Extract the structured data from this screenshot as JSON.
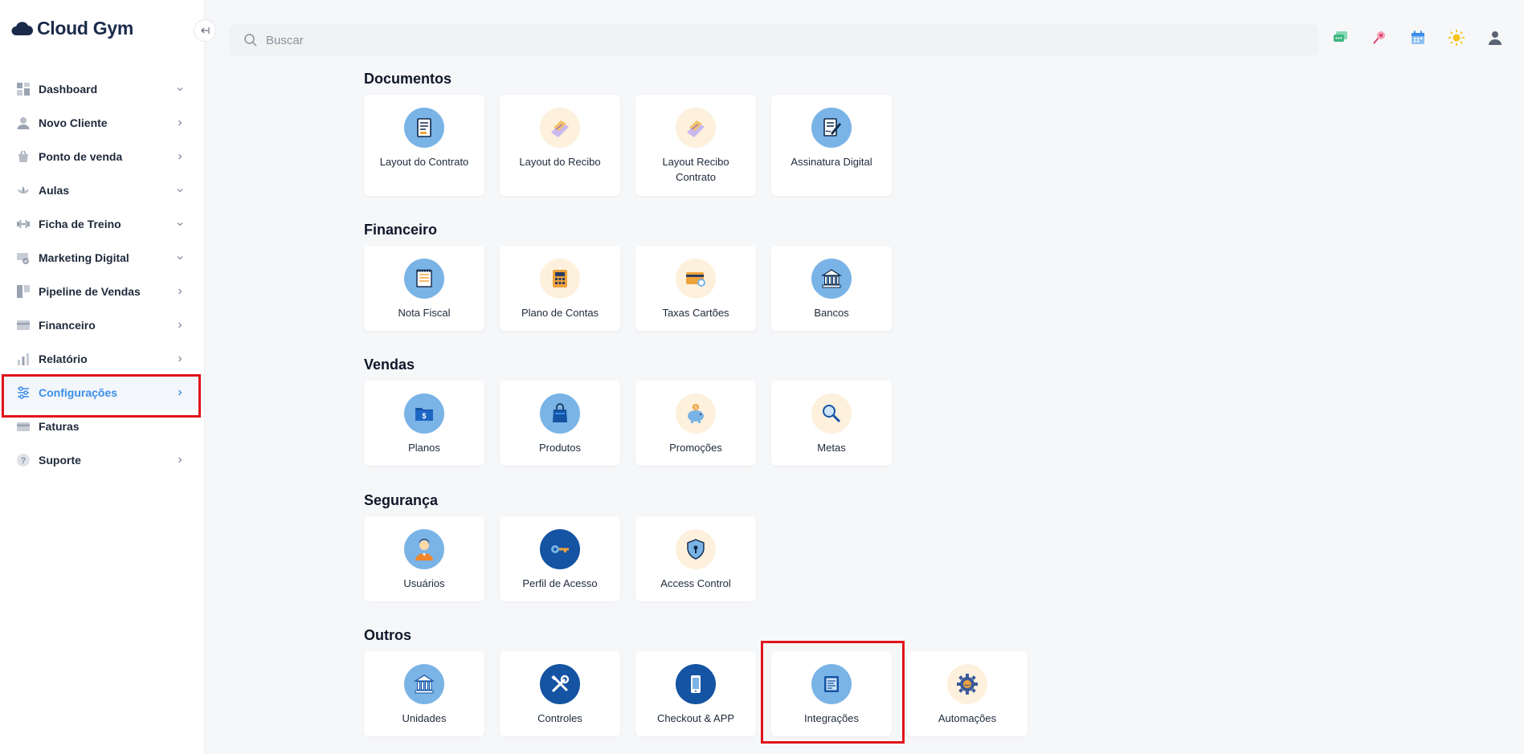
{
  "app": {
    "logo_text": "Cloud Gym"
  },
  "search": {
    "placeholder": "Buscar"
  },
  "sidebar": {
    "items": [
      {
        "label": "Dashboard",
        "icon": "dashboard-icon",
        "chevron": "down"
      },
      {
        "label": "Novo Cliente",
        "icon": "user-icon",
        "chevron": "right"
      },
      {
        "label": "Ponto de venda",
        "icon": "basket-icon",
        "chevron": "right"
      },
      {
        "label": "Aulas",
        "icon": "lotus-icon",
        "chevron": "down"
      },
      {
        "label": "Ficha de Treino",
        "icon": "dumbbell-icon",
        "chevron": "down"
      },
      {
        "label": "Marketing Digital",
        "icon": "marketing-icon",
        "chevron": "down"
      },
      {
        "label": "Pipeline de Vendas",
        "icon": "pipeline-icon",
        "chevron": "right"
      },
      {
        "label": "Financeiro",
        "icon": "finance-icon",
        "chevron": "right"
      },
      {
        "label": "Relatório",
        "icon": "bar-chart-icon",
        "chevron": "right"
      },
      {
        "label": "Configurações",
        "icon": "sliders-icon",
        "chevron": "right",
        "active": true
      },
      {
        "label": "Faturas",
        "icon": "credit-card-icon",
        "chevron": ""
      },
      {
        "label": "Suporte",
        "icon": "help-icon",
        "chevron": "right"
      }
    ]
  },
  "topbar": {
    "icons": [
      "chat-icon",
      "pin-icon",
      "calendar-icon",
      "sun-icon",
      "user-profile-icon"
    ]
  },
  "sections": [
    {
      "title": "Documentos",
      "cards": [
        {
          "label": "Layout do Contrato",
          "icon": "contract-icon",
          "style": "blue"
        },
        {
          "label": "Layout do Recibo",
          "icon": "receipt-icon",
          "style": "cream"
        },
        {
          "label": "Layout Recibo Contrato",
          "icon": "receipt-contract-icon",
          "style": "cream"
        },
        {
          "label": "Assinatura Digital",
          "icon": "signature-icon",
          "style": "blue"
        }
      ]
    },
    {
      "title": "Financeiro",
      "cards": [
        {
          "label": "Nota Fiscal",
          "icon": "invoice-icon",
          "style": "blue"
        },
        {
          "label": "Plano de Contas",
          "icon": "calculator-icon",
          "style": "cream"
        },
        {
          "label": "Taxas Cartões",
          "icon": "card-fees-icon",
          "style": "cream"
        },
        {
          "label": "Bancos",
          "icon": "bank-icon",
          "style": "blue"
        }
      ]
    },
    {
      "title": "Vendas",
      "cards": [
        {
          "label": "Planos",
          "icon": "folder-money-icon",
          "style": "blue"
        },
        {
          "label": "Produtos",
          "icon": "shopping-bag-icon",
          "style": "blue"
        },
        {
          "label": "Promoções",
          "icon": "piggy-bank-icon",
          "style": "cream"
        },
        {
          "label": "Metas",
          "icon": "magnifier-icon",
          "style": "cream"
        }
      ]
    },
    {
      "title": "Segurança",
      "cards": [
        {
          "label": "Usuários",
          "icon": "person-icon",
          "style": "blue"
        },
        {
          "label": "Perfil de Acesso",
          "icon": "key-icon",
          "style": "navy"
        },
        {
          "label": "Access Control",
          "icon": "shield-icon",
          "style": "cream"
        }
      ]
    },
    {
      "title": "Outros",
      "cards": [
        {
          "label": "Unidades",
          "icon": "building-icon",
          "style": "blue"
        },
        {
          "label": "Controles",
          "icon": "tools-icon",
          "style": "navy"
        },
        {
          "label": "Checkout & APP",
          "icon": "phone-icon",
          "style": "navy"
        },
        {
          "label": "Integrações",
          "icon": "integrations-icon",
          "style": "blue"
        },
        {
          "label": "Automações",
          "icon": "gear-icon",
          "style": "cream"
        }
      ]
    }
  ],
  "colors": {
    "accent": "#3b8ee8",
    "highlight": "#e0141b",
    "circle_blue": "#7ab3e6",
    "circle_navy": "#1553a3",
    "circle_cream": "#fdf1dd"
  }
}
